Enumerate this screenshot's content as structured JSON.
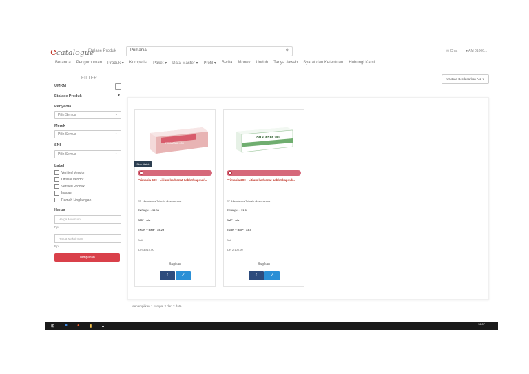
{
  "header": {
    "logo_main": "e",
    "logo_cat": "catalogue",
    "site_label": "Etalase Produk",
    "search_value": "Primania",
    "chat_label": "Chat",
    "user_label": "AM 01006..."
  },
  "nav": [
    "Beranda",
    "Pengumuman",
    "Produk ▾",
    "Kompetisi",
    "Paket ▾",
    "Data Master ▾",
    "Profil ▾",
    "Berita",
    "Monev",
    "Unduh",
    "Tanya Jawab",
    "Syarat dan Ketentuan",
    "Hubungi Kami"
  ],
  "filter": {
    "title": "FILTER",
    "umkm": "UMKM",
    "etalase": "Etalase Produk",
    "penyedia": "Penyedia",
    "penyedia_select": "Pilih Semua",
    "merek": "Merek",
    "merek_select": "Pilih Semua",
    "sni": "SNI",
    "sni_select": "Pilih Semua",
    "label": "Label",
    "labels": [
      "Verified Vendor",
      "Official Vendor",
      "Verified Produk",
      "Inovasi",
      "Ramah Lingkungan"
    ],
    "harga": "Harga",
    "min_placeholder": "Harga Minimum",
    "max_placeholder": "Harga Maksimum",
    "rp": "Rp",
    "button": "Tampilkan"
  },
  "sort_label": "Urutkan Berdasarkan A-Z ▾",
  "products": [
    {
      "stock_badge": "Stok Habis",
      "name": "Primania 400 - Litium karbonat 1ablet/kapsul/...",
      "vendor": "PT. Meraferma Trimaku Mansasane",
      "tkdn": "TKDN(%) : 35.29",
      "bmp": "BMP : n/a",
      "tkdn_bmp": "TKDN + BMP : 35.29",
      "unit": "Buti",
      "price": "IDR 3,810.00",
      "share_label": "Bagikan",
      "box_text": "PRIMANIA 400"
    },
    {
      "stock_badge": "",
      "name": "Primania 200 - Litium karbonat 1ablet/kapsul/...",
      "vendor": "PT. Meraferma Trimaku Mansasane",
      "tkdn": "TKDN(%) : 33.5",
      "bmp": "BMP : n/a",
      "tkdn_bmp": "TKDN + BMP : 33.5",
      "unit": "Buti",
      "price": "IDR 2,100.00",
      "share_label": "Bagikan",
      "box_text": "PRIMANIA 200"
    }
  ],
  "footer_text": "Menampilkan 1 sampai 2 dari 2 data",
  "taskbar_time": "16:07"
}
